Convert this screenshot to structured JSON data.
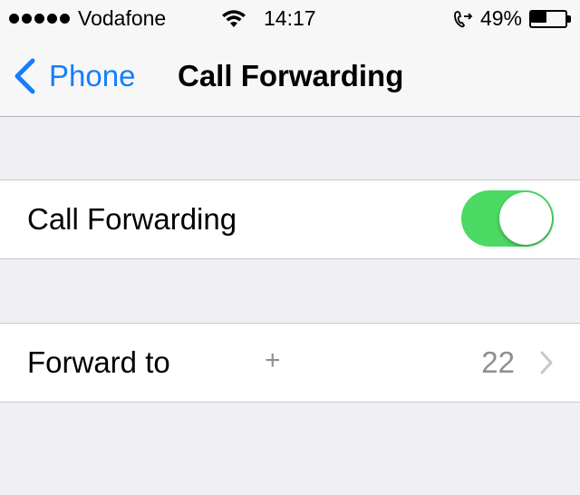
{
  "status_bar": {
    "carrier": "Vodafone",
    "time": "14:17",
    "battery_percent_label": "49%",
    "battery_level": 0.49,
    "signal_bars": 5,
    "icons": [
      "signal-dots",
      "wifi-icon",
      "call-forwarding-icon",
      "battery-icon"
    ]
  },
  "nav": {
    "back_label": "Phone",
    "title": "Call Forwarding",
    "accent_color": "#157efb"
  },
  "call_forwarding_cell": {
    "label": "Call Forwarding",
    "toggle_on": true,
    "toggle_color": "#4cd964"
  },
  "forward_to_cell": {
    "label": "Forward to",
    "number_prefix": "+",
    "number_suffix": "22"
  }
}
